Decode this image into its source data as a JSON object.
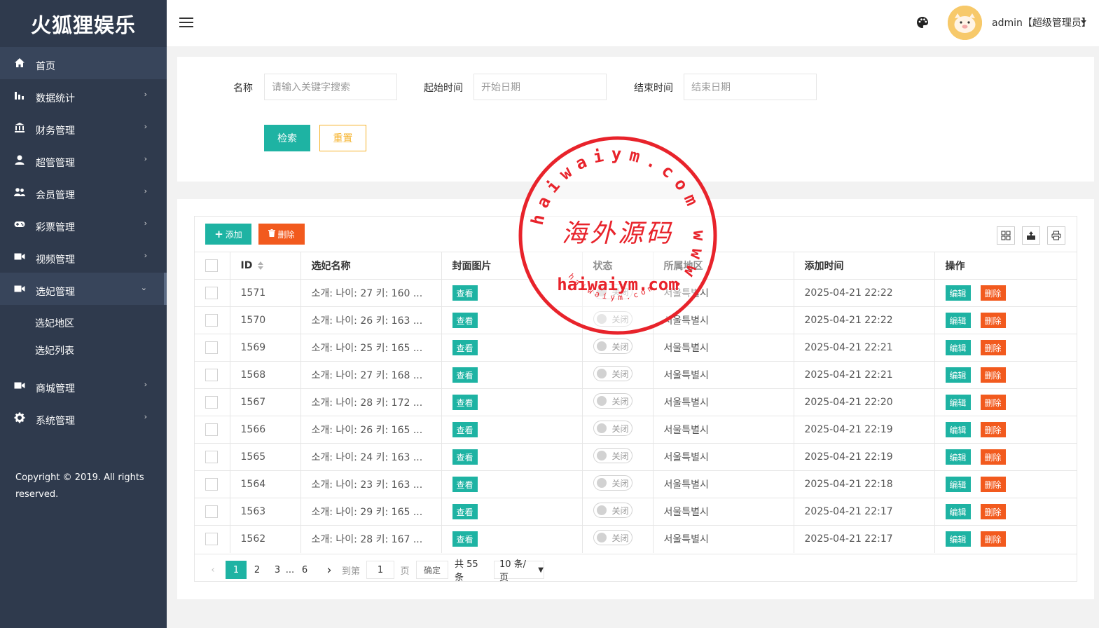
{
  "app": {
    "title": "火狐狸娱乐"
  },
  "sidebar": {
    "items": [
      {
        "label": "首页",
        "icon": "home-icon",
        "arrow": ""
      },
      {
        "label": "数据统计",
        "icon": "bar-chart-icon",
        "arrow": "›"
      },
      {
        "label": "财务管理",
        "icon": "bank-icon",
        "arrow": "›"
      },
      {
        "label": "超管管理",
        "icon": "user-icon",
        "arrow": "›"
      },
      {
        "label": "会员管理",
        "icon": "users-icon",
        "arrow": "›"
      },
      {
        "label": "彩票管理",
        "icon": "gamepad-icon",
        "arrow": "›"
      },
      {
        "label": "视频管理",
        "icon": "video-icon",
        "arrow": "›"
      },
      {
        "label": "选妃管理",
        "icon": "video-icon",
        "arrow": "⌄"
      }
    ],
    "submenu": [
      "选妃地区",
      "选妃列表"
    ],
    "items_after": [
      {
        "label": "商城管理",
        "icon": "video-icon",
        "arrow": "›"
      },
      {
        "label": "系统管理",
        "icon": "gear-icon",
        "arrow": "›"
      }
    ],
    "copyright": "Copyright © 2019. All rights reserved."
  },
  "header": {
    "user_label": "admin【超级管理员】"
  },
  "search": {
    "name_label": "名称",
    "name_placeholder": "请输入关键字搜索",
    "start_label": "起始时间",
    "start_placeholder": "开始日期",
    "end_label": "结束时间",
    "end_placeholder": "结束日期",
    "search_button": "检索",
    "reset_button": "重置"
  },
  "toolbar": {
    "add_label": "添加",
    "delete_label": "删除"
  },
  "table": {
    "columns": [
      "ID",
      "选妃名称",
      "封面图片",
      "状态",
      "所属地区",
      "添加时间",
      "操作"
    ],
    "view_label": "查看",
    "toggle_label": "关闭",
    "edit_label": "编辑",
    "remove_label": "删除",
    "rows": [
      {
        "id": "1571",
        "name": "소개: 나이: 27 키: 160 ...",
        "region": "서울특별시",
        "time": "2025-04-21 22:22"
      },
      {
        "id": "1570",
        "name": "소개: 나이: 26 키: 163 ...",
        "region": "서울특별시",
        "time": "2025-04-21 22:22"
      },
      {
        "id": "1569",
        "name": "소개: 나이: 25 키: 165 ...",
        "region": "서울특별시",
        "time": "2025-04-21 22:21"
      },
      {
        "id": "1568",
        "name": "소개: 나이: 27 키: 168 ...",
        "region": "서울특별시",
        "time": "2025-04-21 22:21"
      },
      {
        "id": "1567",
        "name": "소개: 나이: 28 키: 172 ...",
        "region": "서울특별시",
        "time": "2025-04-21 22:20"
      },
      {
        "id": "1566",
        "name": "소개: 나이: 26 키: 165 ...",
        "region": "서울특별시",
        "time": "2025-04-21 22:19"
      },
      {
        "id": "1565",
        "name": "소개: 나이: 24 키: 163 ...",
        "region": "서울특별시",
        "time": "2025-04-21 22:19"
      },
      {
        "id": "1564",
        "name": "소개: 나이: 23 키: 163 ...",
        "region": "서울특별시",
        "time": "2025-04-21 22:18"
      },
      {
        "id": "1563",
        "name": "소개: 나이: 29 키: 165 ...",
        "region": "서울특별시",
        "time": "2025-04-21 22:17"
      },
      {
        "id": "1562",
        "name": "소개: 나이: 28 키: 167 ...",
        "region": "서울특별시",
        "time": "2025-04-21 22:17"
      }
    ]
  },
  "pagination": {
    "current": "1",
    "pages": [
      "2",
      "3",
      "...",
      "6"
    ],
    "goto_label": "到第",
    "goto_value": "1",
    "page_suffix": "页",
    "confirm_label": "确定",
    "total_label": "共 55 条",
    "per_page": "10 条/页"
  },
  "watermark": {
    "ring_text": "haiwaiym.com  www.",
    "center_text": "海外源码",
    "domain_text": "haiwaiym.com",
    "small_text": "haiwaiym.com"
  },
  "colors": {
    "sidebar": "#2f3a4d",
    "teal": "#1eb3a3",
    "orange": "#f25a1e",
    "gold": "#f5b22a",
    "stamp": "#e8232b"
  }
}
